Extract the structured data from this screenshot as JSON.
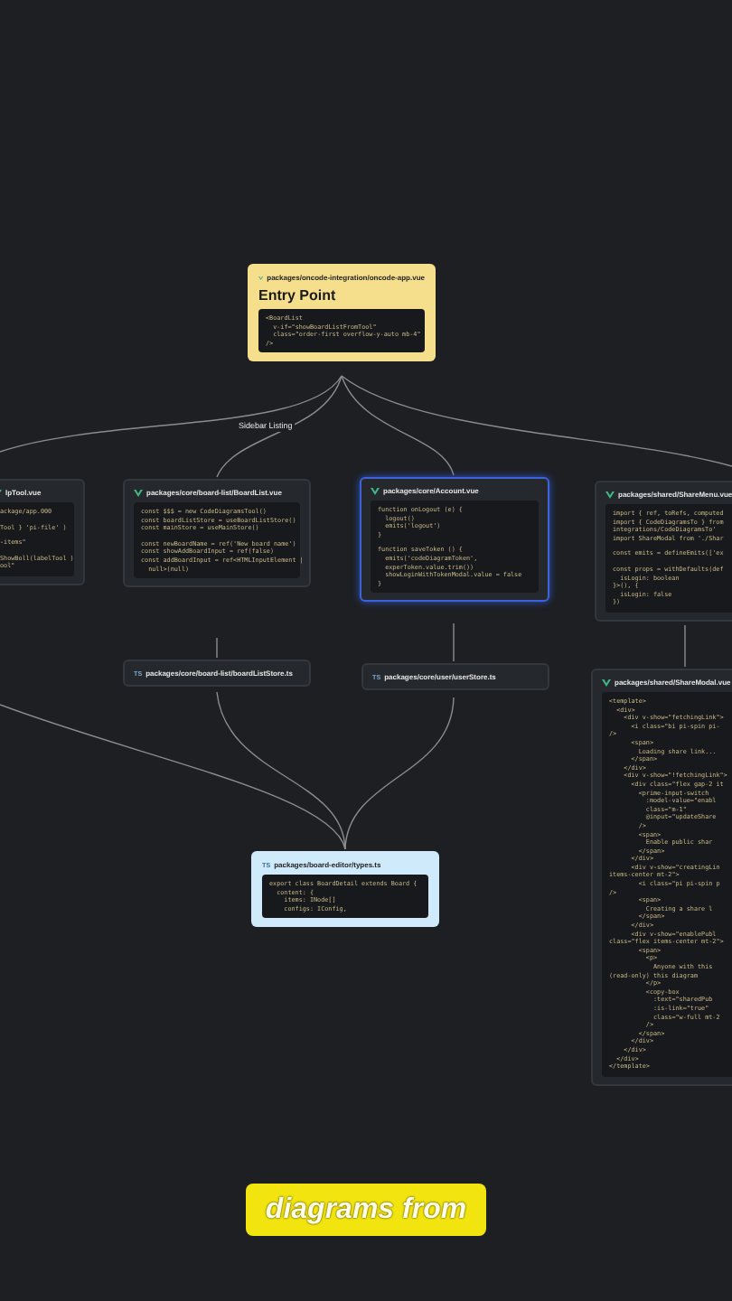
{
  "nodes": [
    {
      "path": "packages/oncode-integration/oncode-app.vue",
      "heading": "Entry Point",
      "color": "#f6df8c",
      "selected": false,
      "code": [
        [
          "<BoardList",
          "  v-if=\"showBoardListFromTool\"",
          "  class=\"order-first overflow-y-auto mb-4\"",
          "/>"
        ]
      ]
    },
    {
      "path": "lpTool.vue",
      "color": "#25282c",
      "selected": false,
      "code": [
        [
          "ackage/app.000"
        ],
        [
          "Tool } 'pi-file' )"
        ],
        [
          "-items\""
        ],
        [
          "ShowBoll(labelTool )",
          "ool\""
        ]
      ]
    },
    {
      "path": "packages/core/board-list/BoardList.vue",
      "color": "#25282c",
      "selected": false,
      "code": [
        [
          "const $$$ = new CodeDiagramsTool()",
          "const boardListStore = useBoardListStore()",
          "const mainStore = useMainStore()"
        ],
        [
          "const newBoardName = ref('New board name')",
          "const showAddBoardInput = ref(false)",
          "const addBoardInput = ref<HTMLInputElement |",
          "  null>(null)"
        ]
      ]
    },
    {
      "path": "packages/core/Account.vue",
      "color": "#25282c",
      "selected": true,
      "code": [
        [
          "function onLogout (e) {",
          "  logout()",
          "  emits('logout')",
          "}"
        ],
        [
          "function saveToken () {",
          "  emits('codeDiagramToken',",
          "  experToken.value.trim())",
          "  showLoginWithTokenModal.value = false",
          "}"
        ]
      ]
    },
    {
      "path": "packages/shared/ShareMenu.vue",
      "color": "#25282c",
      "selected": false,
      "code": [
        [
          "import { ref, toRefs, computed",
          "import { CodeDiagramsTo } from",
          "integrations/CodeDiagramsTo'",
          "import ShareModal from './Shar"
        ],
        [
          "const emits = defineEmits(['ex"
        ],
        [
          "const props = withDefaults(def",
          "  isLogin: boolean",
          "}>(), {",
          "  isLogin: false",
          "})"
        ]
      ]
    },
    {
      "badge": "TS",
      "path": "packages/core/board-list/boardListStore.ts",
      "color": "#25282c",
      "selected": false
    },
    {
      "badge": "TS",
      "path": "packages/core/user/userStore.ts",
      "color": "#25282c",
      "selected": false
    },
    {
      "badge": "TS",
      "path": "packages/board-editor/types.ts",
      "color": "#cfeafb",
      "selected": false,
      "code": [
        [
          "export class BoardDetail extends Board {",
          "  content: {",
          "    items: INode[]",
          "    configs: IConfig,"
        ]
      ]
    },
    {
      "path": "packages/shared/ShareModal.vue",
      "color": "#25282c",
      "selected": false,
      "code": [
        [
          "<template>",
          "  <div>",
          "    <div v-show=\"fetchingLink\">",
          "      <i class=\"bi pi-spin pi-",
          "/>",
          "      <span>",
          "        Loading share link...",
          "      </span>",
          "    </div>",
          "    <div v-show=\"!fetchingLink\">",
          "      <div class=\"flex gap-2 it",
          "        <prime-input-switch",
          "          :model-value=\"enabl",
          "          class=\"m-1\"",
          "          @input=\"updateShare",
          "        />",
          "        <span>",
          "          Enable public shar",
          "        </span>",
          "      </div>",
          "      <div v-show=\"creatingLin",
          "items-center mt-2\">",
          "        <i class=\"pi pi-spin p",
          "/>",
          "        <span>",
          "          Creating a share l",
          "        </span>",
          "      </div>",
          "      <div v-show=\"enablePubl",
          "class=\"flex items-center mt-2\">",
          "        <span>",
          "          <p>",
          "            Anyone with this",
          "(read-only) this diagram",
          "          </p>",
          "          <copy-box",
          "            :text=\"sharedPub",
          "            :is-link=\"true\"",
          "            class=\"w-full mt-2",
          "          />",
          "        </span>",
          "      </div>",
          "    </div>",
          "  </div>",
          "</template>"
        ]
      ]
    }
  ],
  "edge_label": "Sidebar Listing",
  "caption": "diagrams from"
}
